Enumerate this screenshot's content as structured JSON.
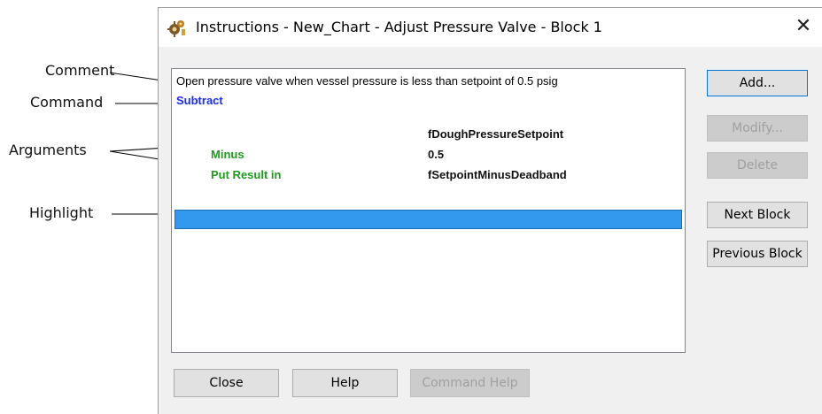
{
  "callouts": {
    "comment": "Comment",
    "command": "Command",
    "arguments": "Arguments",
    "highlight": "Highlight"
  },
  "dialog": {
    "title": "Instructions - New_Chart - Adjust Pressure Valve - Block 1",
    "close_glyph": "✕",
    "icon": "gear-app-icon"
  },
  "instructions": {
    "comment": "Open pressure valve when vessel pressure is less than setpoint of 0.5 psig",
    "command": "Subtract",
    "first_operand": "fDoughPressureSetpoint",
    "args": [
      {
        "name": "Minus",
        "value": "0.5"
      },
      {
        "name": "Put Result in",
        "value": "fSetpointMinusDeadband"
      }
    ]
  },
  "side_buttons": {
    "add": "Add...",
    "modify": "Modify...",
    "delete": "Delete",
    "next_block": "Next Block",
    "previous_block": "Previous Block"
  },
  "bottom_buttons": {
    "close": "Close",
    "help": "Help",
    "command_help": "Command Help"
  },
  "colors": {
    "command": "#1a2bff",
    "argument_name": "#1e9a1e",
    "highlight": "#3399ee"
  }
}
